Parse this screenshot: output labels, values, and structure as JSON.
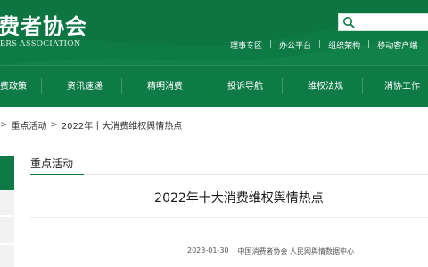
{
  "header": {
    "logo_cn": "费者协会",
    "logo_en": "ERS ASSOCIATION",
    "bg_color": "#0e7a45"
  },
  "search": {
    "placeholder": "",
    "icon": "search-icon"
  },
  "top_links": [
    "理事专区",
    "办公平台",
    "组织架构",
    "移动客户端"
  ],
  "nav": {
    "items": [
      "费政策",
      "资讯速递",
      "精明消费",
      "投诉导航",
      "维权法规",
      "消协工作"
    ]
  },
  "breadcrumb": {
    "items": [
      "重点活动",
      "2022年十大消费维权舆情热点"
    ],
    "separator": ">"
  },
  "section": {
    "title": "重点活动"
  },
  "article": {
    "title": "2022年十大消费维权舆情热点",
    "date": "2023-01-30",
    "source": "中国消费者协会 人民网舆情数据中心"
  }
}
